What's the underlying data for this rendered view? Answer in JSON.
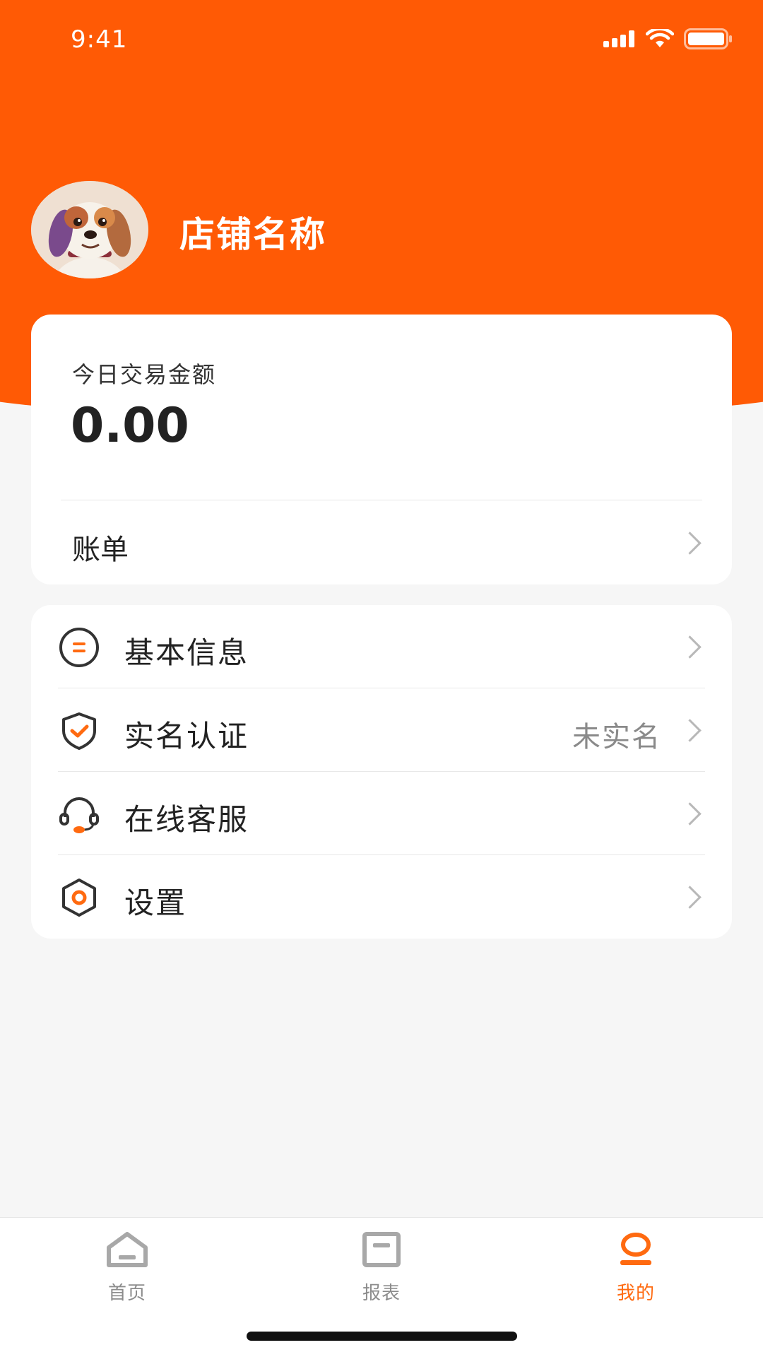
{
  "status_bar": {
    "time": "9:41"
  },
  "profile": {
    "shop_name": "店铺名称",
    "avatar_icon": "dog-avatar"
  },
  "today_card": {
    "label": "今日交易金额",
    "amount": "0.00",
    "bill_label": "账单"
  },
  "menu": {
    "items": [
      {
        "label": "基本信息",
        "icon": "info-list-icon",
        "value": ""
      },
      {
        "label": "实名认证",
        "icon": "shield-check-icon",
        "value": "未实名"
      },
      {
        "label": "在线客服",
        "icon": "headset-icon",
        "value": ""
      },
      {
        "label": "设置",
        "icon": "hexagon-settings-icon",
        "value": ""
      }
    ]
  },
  "tab_bar": {
    "tabs": [
      {
        "label": "首页",
        "icon": "home-icon",
        "active": false
      },
      {
        "label": "报表",
        "icon": "report-icon",
        "active": false
      },
      {
        "label": "我的",
        "icon": "profile-icon",
        "active": true
      }
    ]
  },
  "colors": {
    "brand": "#ff5a05",
    "accent": "#ff6a10",
    "inactive": "#8c8c8c"
  }
}
